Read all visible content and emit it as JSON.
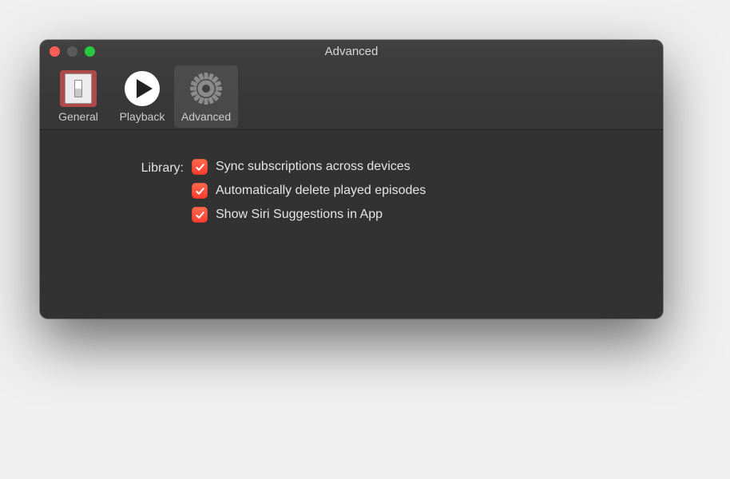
{
  "window": {
    "title": "Advanced"
  },
  "toolbar": {
    "items": [
      {
        "label": "General"
      },
      {
        "label": "Playback"
      },
      {
        "label": "Advanced"
      }
    ]
  },
  "content": {
    "section_label": "Library:",
    "options": [
      {
        "label": "Sync subscriptions across devices",
        "checked": true
      },
      {
        "label": "Automatically delete played episodes",
        "checked": true
      },
      {
        "label": "Show Siri Suggestions in App",
        "checked": true
      }
    ]
  }
}
